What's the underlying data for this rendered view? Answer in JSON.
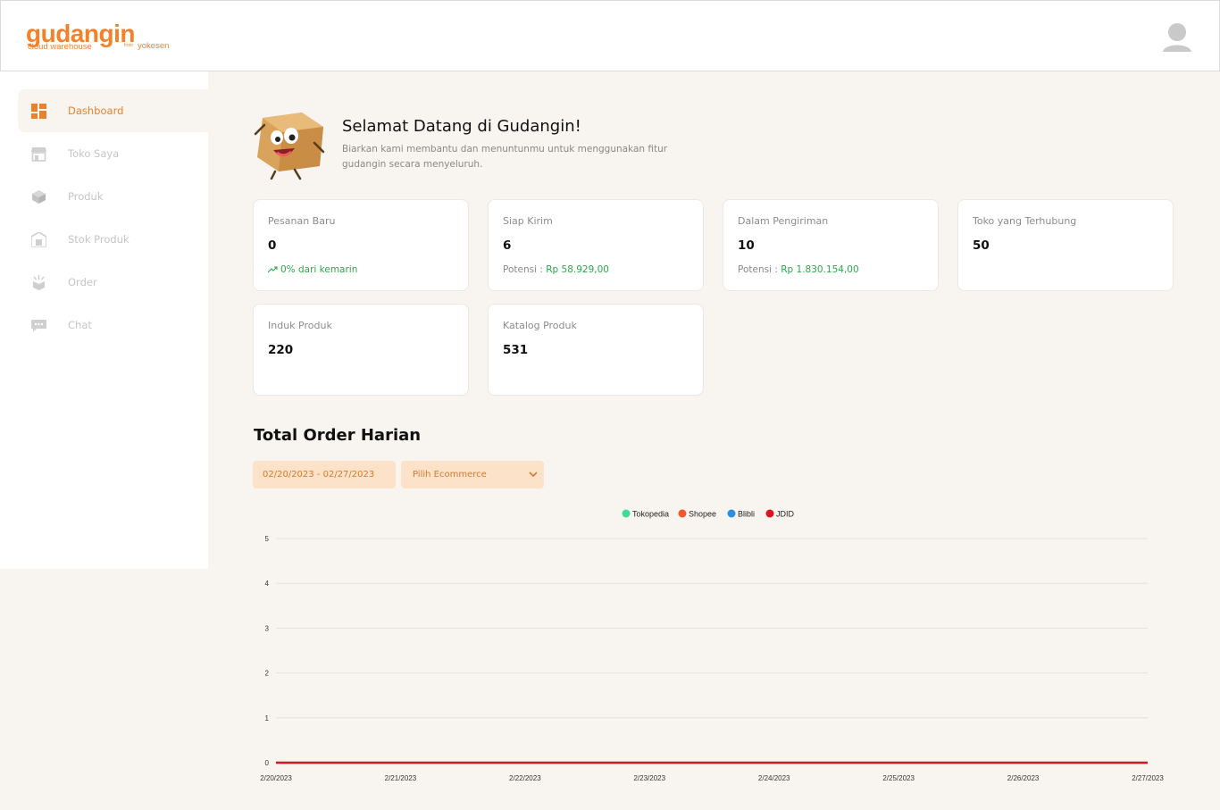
{
  "header": {
    "logo_main": "gudangin",
    "logo_sub": "cloud warehouse",
    "logo_from": "from",
    "logo_company": "yokesen"
  },
  "sidebar": {
    "items": [
      {
        "label": "Dashboard",
        "icon": "dashboard-icon",
        "active": true
      },
      {
        "label": "Toko Saya",
        "icon": "store-icon",
        "active": false
      },
      {
        "label": "Produk",
        "icon": "box-icon",
        "active": false
      },
      {
        "label": "Stok Produk",
        "icon": "warehouse-icon",
        "active": false
      },
      {
        "label": "Order",
        "icon": "order-icon",
        "active": false
      },
      {
        "label": "Chat",
        "icon": "chat-icon",
        "active": false
      }
    ]
  },
  "welcome": {
    "title": "Selamat Datang di Gudangin!",
    "subtitle": "Biarkan kami membantu dan menuntunmu untuk menggunakan fitur gudangin secara menyeluruh."
  },
  "cards": [
    {
      "label": "Pesanan Baru",
      "value": "0",
      "extra_prefix": "",
      "extra_value": "0% dari kemarin",
      "trend": true
    },
    {
      "label": "Siap Kirim",
      "value": "6",
      "extra_prefix": "Potensi : ",
      "extra_value": "Rp 58.929,00",
      "trend": false
    },
    {
      "label": "Dalam Pengiriman",
      "value": "10",
      "extra_prefix": "Potensi : ",
      "extra_value": "Rp 1.830.154,00",
      "trend": false
    },
    {
      "label": "Toko yang Terhubung",
      "value": "50",
      "extra_prefix": "",
      "extra_value": "",
      "trend": false
    },
    {
      "label": "Induk Produk",
      "value": "220",
      "extra_prefix": "",
      "extra_value": "",
      "trend": false
    },
    {
      "label": "Katalog Produk",
      "value": "531",
      "extra_prefix": "",
      "extra_value": "",
      "trend": false
    }
  ],
  "orders": {
    "title": "Total Order Harian",
    "date_range": "02/20/2023 - 02/27/2023",
    "ecommerce_placeholder": "Pilih Ecommerce"
  },
  "colors": {
    "accent": "#e8832d",
    "positive": "#2aa84a"
  },
  "chart_data": {
    "type": "line",
    "categories": [
      "2/20/2023",
      "2/21/2023",
      "2/22/2023",
      "2/23/2023",
      "2/24/2023",
      "2/25/2023",
      "2/26/2023",
      "2/27/2023"
    ],
    "series": [
      {
        "name": "Tokopedia",
        "color": "#3ddc97",
        "values": [
          0,
          0,
          0,
          0,
          0,
          0,
          0,
          0
        ]
      },
      {
        "name": "Shopee",
        "color": "#f0592b",
        "values": [
          0,
          0,
          0,
          0,
          0,
          0,
          0,
          0
        ]
      },
      {
        "name": "Blibli",
        "color": "#2f8fdc",
        "values": [
          0,
          0,
          0,
          0,
          0,
          0,
          0,
          0
        ]
      },
      {
        "name": "JDID",
        "color": "#e0121b",
        "values": [
          0,
          0,
          0,
          0,
          0,
          0,
          0,
          0
        ]
      }
    ],
    "yticks": [
      0,
      1,
      2,
      3,
      4,
      5
    ],
    "ylim": [
      0,
      5
    ],
    "grid": true,
    "legend": "top-center"
  }
}
